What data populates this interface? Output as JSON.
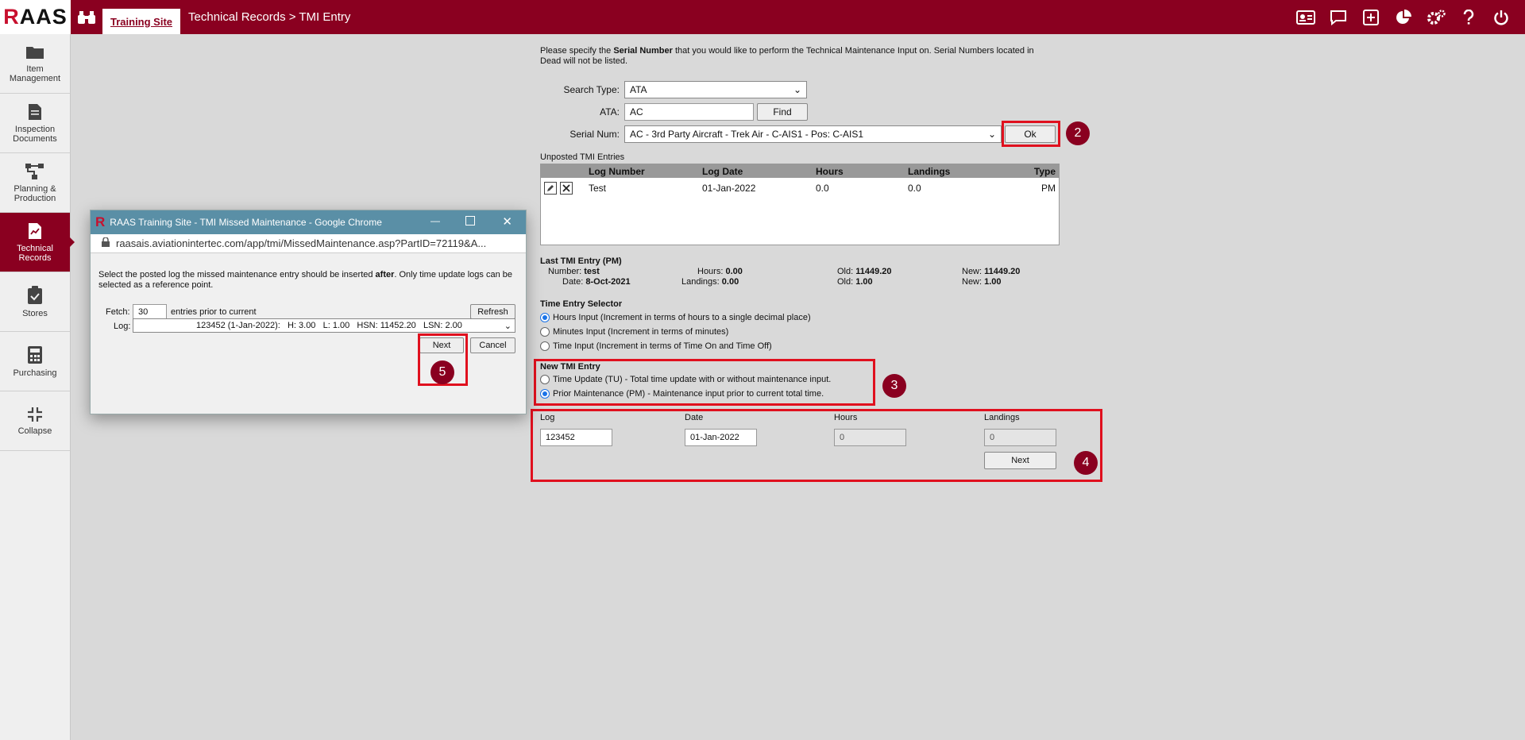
{
  "header": {
    "logo_r": "R",
    "logo_rest": "AAS",
    "site_tab": "Training Site",
    "breadcrumb": "Technical Records > TMI Entry"
  },
  "sidebar": {
    "items": [
      {
        "label": "Item Management",
        "icon": "folder-icon"
      },
      {
        "label": "Inspection Documents",
        "icon": "document-icon"
      },
      {
        "label": "Planning & Production",
        "icon": "flow-icon"
      },
      {
        "label": "Technical Records",
        "icon": "chart-doc-icon"
      },
      {
        "label": "Stores",
        "icon": "clipboard-check-icon"
      },
      {
        "label": "Purchasing",
        "icon": "calculator-icon"
      },
      {
        "label": "Collapse",
        "icon": "collapse-icon"
      }
    ]
  },
  "main": {
    "intro_part1": "Please specify the ",
    "intro_bold": "Serial Number",
    "intro_part2": " that you would like to perform the Technical Maintenance Input on. Serial Numbers located in Dead will not be listed.",
    "search_type_label": "Search Type:",
    "search_type_value": "ATA",
    "ata_label": "ATA:",
    "ata_value": "AC",
    "find_label": "Find",
    "serial_label": "Serial Num:",
    "serial_value": "AC - 3rd Party Aircraft - Trek Air - C-AIS1 - Pos: C-AIS1",
    "ok_label": "Ok",
    "unposted_title": "Unposted TMI Entries",
    "table_headers": {
      "log": "Log Number",
      "date": "Log Date",
      "hours": "Hours",
      "landings": "Landings",
      "type": "Type"
    },
    "table_row": {
      "log": "Test",
      "date": "01-Jan-2022",
      "hours": "0.0",
      "landings": "0.0",
      "type": "PM"
    },
    "last_tmi": {
      "title": "Last TMI Entry (PM)",
      "number_label": "Number:",
      "number_value": "test",
      "date_label": "Date:",
      "date_value": "8-Oct-2021",
      "hours_label": "Hours:",
      "hours_value": "0.00",
      "landings_label": "Landings:",
      "landings_value": "0.00",
      "old_label": "Old:",
      "old_hours": "11449.20",
      "old_landings": "1.00",
      "new_label": "New:",
      "new_hours": "11449.20",
      "new_landings": "1.00"
    },
    "time_selector": {
      "title": "Time Entry Selector",
      "options": [
        "Hours Input (Increment in terms of hours to a single decimal place)",
        "Minutes Input (Increment in terms of minutes)",
        "Time Input (Increment in terms of Time On and Time Off)"
      ]
    },
    "new_tmi": {
      "title": "New TMI Entry",
      "options": [
        "Time Update (TU) - Total time update with or without maintenance input.",
        "Prior Maintenance (PM) - Maintenance input prior to current total time."
      ]
    },
    "entry_form": {
      "log_label": "Log",
      "log_value": "123452",
      "date_label": "Date",
      "date_value": "01-Jan-2022",
      "hours_label": "Hours",
      "hours_value": "0",
      "landings_label": "Landings",
      "landings_value": "0",
      "next_label": "Next"
    },
    "badges": [
      "2",
      "3",
      "4"
    ]
  },
  "popup": {
    "title": "RAAS Training Site - TMI Missed Maintenance - Google Chrome",
    "url": "raasais.aviationintertec.com/app/tmi/MissedMaintenance.asp?PartID=72119&A...",
    "instr_part1": "Select the posted log the missed maintenance entry should be inserted ",
    "instr_bold": "after",
    "instr_part2": ". Only time update logs can be selected as a reference point.",
    "fetch_label": "Fetch:",
    "fetch_value": "30",
    "fetch_suffix": "entries prior to current",
    "refresh_label": "Refresh",
    "log_label": "Log:",
    "log_value": "123452 (1-Jan-2022):   H: 3.00   L: 1.00   HSN: 11452.20   LSN: 2.00",
    "next_label": "Next",
    "cancel_label": "Cancel",
    "badge": "5"
  },
  "colors": {
    "brand": "#8a0020",
    "annotation": "#e0101e",
    "popup_title": "#5a8fa6"
  }
}
